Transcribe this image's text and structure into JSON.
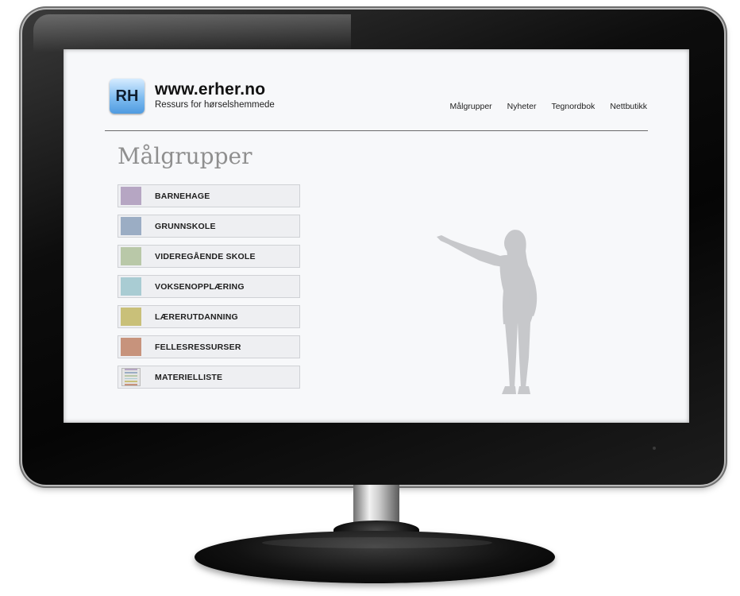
{
  "site": {
    "logo_text": "RH",
    "url": "www.erher.no",
    "tagline": "Ressurs for hørselshemmede"
  },
  "nav": {
    "items": [
      "Målgrupper",
      "Nyheter",
      "Tegnordbok",
      "Nettbutikk"
    ]
  },
  "page": {
    "title": "Målgrupper"
  },
  "menu": {
    "items": [
      {
        "label": "BARNEHAGE",
        "color": "#b6a6c3"
      },
      {
        "label": "GRUNNSKOLE",
        "color": "#9badc4"
      },
      {
        "label": "VIDEREGÅENDE SKOLE",
        "color": "#b9c8a8"
      },
      {
        "label": "VOKSENOPPLÆRING",
        "color": "#a9ccd3"
      },
      {
        "label": "LÆRERUTDANNING",
        "color": "#c9c079"
      },
      {
        "label": "FELLESRESSURSER",
        "color": "#c7937c"
      },
      {
        "label": "MATERIELLISTE",
        "icon": "document-list-icon"
      }
    ]
  },
  "colors": {
    "title_gray": "#8f8f8f",
    "silhouette_gray": "#c7c8cb",
    "logo_blue": "#4f9be0"
  }
}
